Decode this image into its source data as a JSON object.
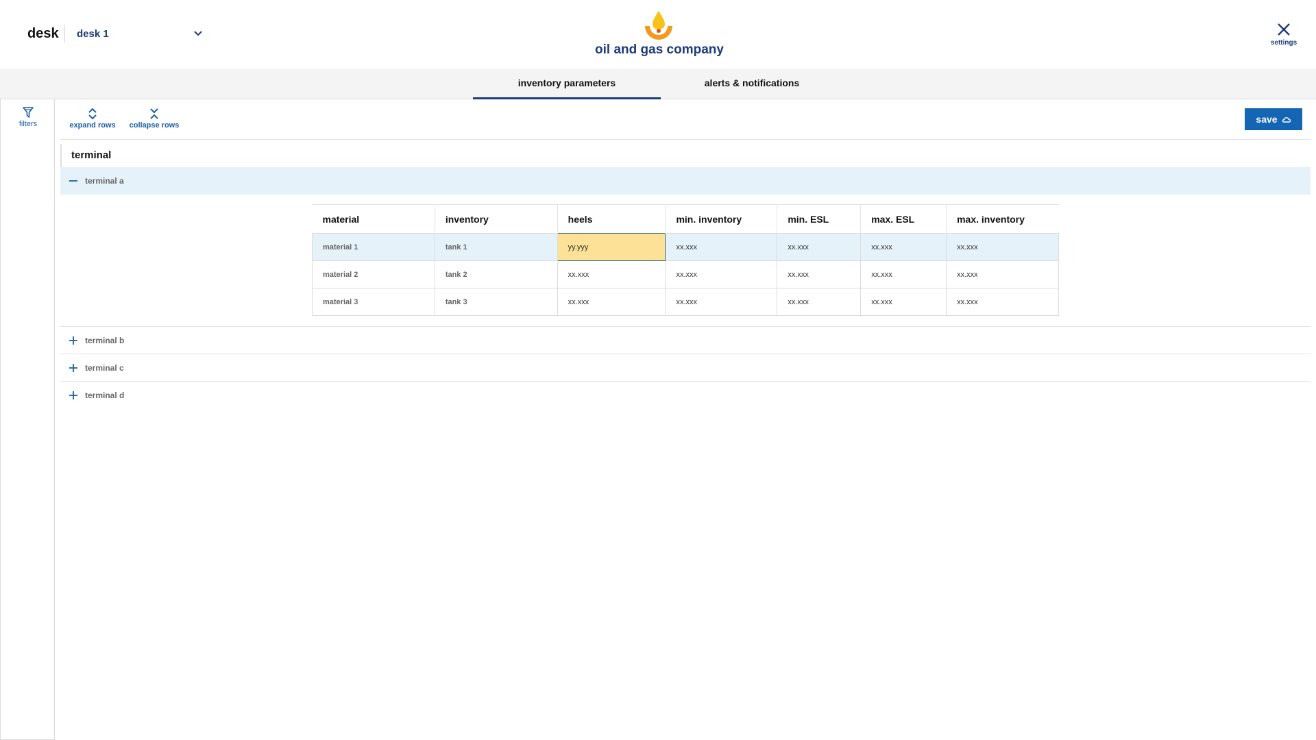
{
  "header": {
    "desk_label": "desk",
    "desk_selected": "desk 1",
    "company_name": "oil and gas company",
    "settings_label": "settings"
  },
  "tabs": [
    {
      "label": "inventory parameters",
      "active": true
    },
    {
      "label": "alerts & notifications",
      "active": false
    }
  ],
  "left_rail": {
    "filters_label": "filters"
  },
  "toolbar": {
    "expand_label": "expand rows",
    "collapse_label": "collapse rows",
    "save_label": "save"
  },
  "terminal_header": "terminal",
  "terminals": [
    {
      "label": "terminal a",
      "expanded": true
    },
    {
      "label": "terminal b",
      "expanded": false
    },
    {
      "label": "terminal c",
      "expanded": false
    },
    {
      "label": "terminal d",
      "expanded": false
    }
  ],
  "table": {
    "columns": [
      "material",
      "inventory",
      "heels",
      "min. inventory",
      "min. ESL",
      "max. ESL",
      "max. inventory"
    ],
    "rows": [
      [
        "material 1",
        "tank 1",
        "yy.yyy",
        "xx.xxx",
        "xx.xxx",
        "xx.xxx",
        "xx.xxx"
      ],
      [
        "material 2",
        "tank 2",
        "xx.xxx",
        "xx.xxx",
        "xx.xxx",
        "xx.xxx",
        "xx.xxx"
      ],
      [
        "material 3",
        "tank 3",
        "xx.xxx",
        "xx.xxx",
        "xx.xxx",
        "xx.xxx",
        "xx.xxx"
      ]
    ]
  },
  "colors": {
    "brand_navy": "#1c3b7a",
    "accent_blue": "#1565b5",
    "row_highlight": "#e5f2f9",
    "edit_cell": "#fde197",
    "logo_yellow": "#f7c21b",
    "logo_orange": "#f39a1e"
  }
}
